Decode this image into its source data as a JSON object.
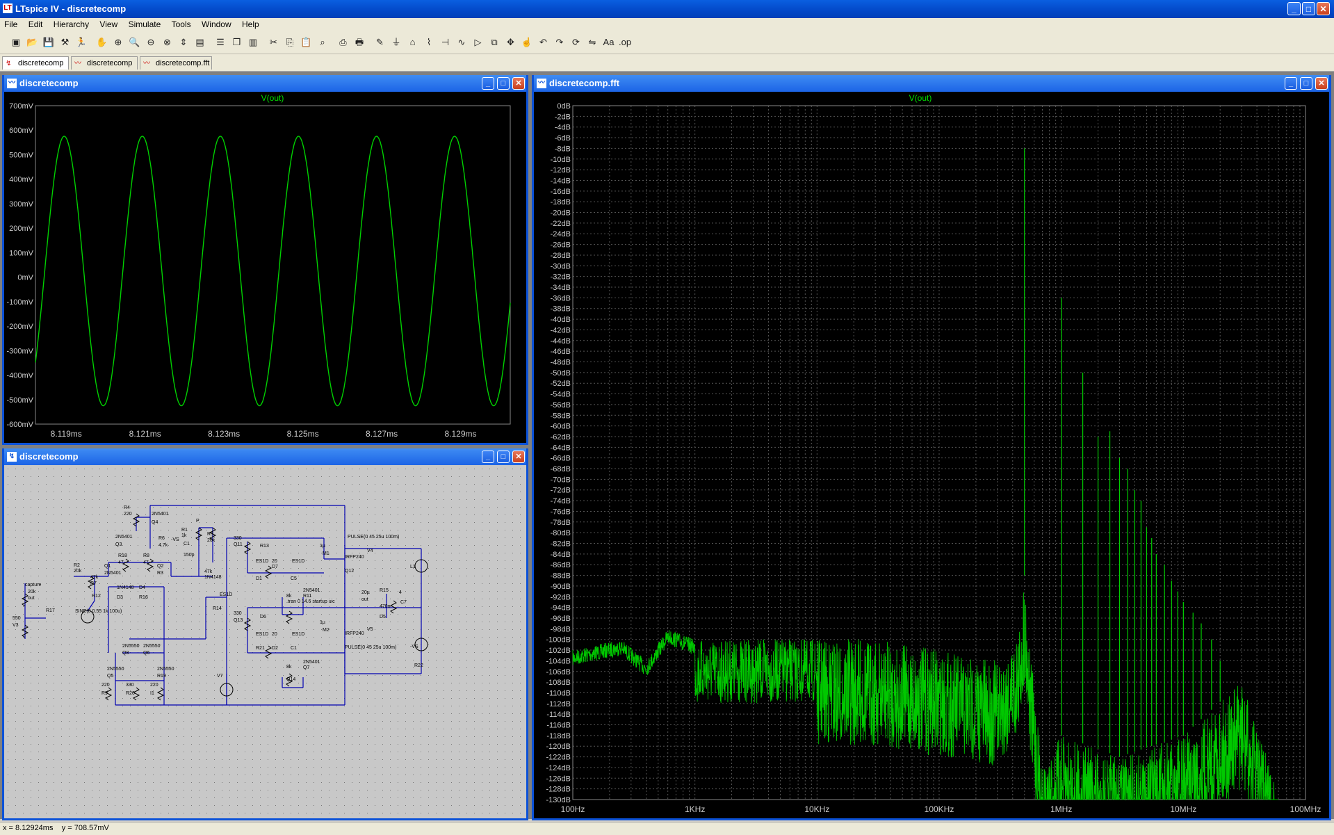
{
  "app": {
    "title": "LTspice IV - discretecomp"
  },
  "window_controls": {
    "minimize": "_",
    "maximize": "□",
    "close": "✕"
  },
  "menu": [
    "File",
    "Edit",
    "Hierarchy",
    "View",
    "Simulate",
    "Tools",
    "Window",
    "Help"
  ],
  "toolbar_icons": [
    "new-schematic-icon",
    "open-icon",
    "save-icon",
    "control-panel-icon",
    "run-icon",
    "halt-icon",
    "zoom-in-icon",
    "zoom-area-icon",
    "zoom-out-icon",
    "zoom-cancel-icon",
    "autorange-icon",
    "mark-icon",
    "tile-horizontal-icon",
    "cascade-icon",
    "tile-vertical-icon",
    "cut-icon",
    "copy-icon",
    "paste-icon",
    "find-icon",
    "print-preview-icon",
    "print-icon",
    "wire-icon",
    "ground-icon",
    "label-icon",
    "resistor-icon",
    "capacitor-icon",
    "inductor-icon",
    "diode-icon",
    "component-icon",
    "move-icon",
    "drag-icon",
    "undo-icon",
    "redo-icon",
    "rotate-icon",
    "mirror-icon",
    "text-icon",
    "spice-directive-icon"
  ],
  "tabs": [
    {
      "label": "discretecomp",
      "icon": "schematic-icon",
      "active": true
    },
    {
      "label": "discretecomp",
      "icon": "waveform-icon",
      "active": false
    },
    {
      "label": "discretecomp.fft",
      "icon": "waveform-icon",
      "active": false
    }
  ],
  "windows": {
    "wave": {
      "title": "discretecomp"
    },
    "schematic": {
      "title": "discretecomp"
    },
    "fft": {
      "title": "discretecomp.fft"
    }
  },
  "schematic": {
    "labels": [
      "R4",
      "220",
      "2N5401",
      "Q4",
      "2N5401",
      "Q3",
      "R6",
      "4.7k",
      "-VS",
      "R1",
      "1k",
      "C1",
      "150p",
      "P",
      "R5",
      "20k",
      "R18",
      "47",
      "R8",
      "47",
      "R2",
      "20k",
      "Q1",
      "2N5401",
      "Q2",
      "R3",
      "47k",
      "R7",
      "47k",
      "1N4148",
      "1N4148",
      "D3",
      "D4",
      "R16",
      "20k",
      "out",
      "capture",
      "R17",
      "550",
      "V3",
      "SINE(0 0.55 1k 100u)",
      "R12",
      "330",
      "Q11",
      "R13",
      "20",
      "D7",
      "ES1D",
      "D1",
      "ES1D",
      "C5",
      "1µ",
      "M1",
      "IRFP240",
      "Q12",
      "2N5401",
      "R11",
      "8k",
      ".tran 0 14.6 startup uic",
      "PULSE(0 45 25u 100m)",
      "V4",
      "L1",
      "20µ",
      "out",
      "R15",
      "4",
      "C7",
      "470n",
      "D5",
      "ES1D",
      "R14",
      "330",
      "Q13",
      "D6",
      "ES1D",
      "R21",
      "20",
      "D2",
      "ES1D",
      "C1",
      "1µ",
      "M2",
      "IRFP240",
      "PULSE(0 45 25u 100m)",
      "V5",
      "-VS",
      "R22",
      "8k",
      "Q14",
      "2N5401",
      "Q7",
      "2N5550",
      "Q8",
      "2N5550",
      "Q6",
      "2N5550",
      "Q5",
      "2N5550",
      "R19",
      "220",
      "R9",
      "330",
      "R20",
      "220",
      "I1",
      "V7"
    ]
  },
  "status": {
    "x": "x = 8.12924ms",
    "y": "y = 708.57mV"
  },
  "chart_data": [
    {
      "type": "line",
      "title": "V(out)",
      "xlabel": "",
      "ylabel": "",
      "x_ticks": [
        "8.119ms",
        "8.121ms",
        "8.123ms",
        "8.125ms",
        "8.127ms",
        "8.129ms"
      ],
      "y_ticks": [
        "700mV",
        "600mV",
        "500mV",
        "400mV",
        "300mV",
        "200mV",
        "100mV",
        "0mV",
        "-100mV",
        "-200mV",
        "-300mV",
        "-400mV",
        "-500mV",
        "-600mV"
      ],
      "xlim_ms": [
        8.11822,
        8.13026
      ],
      "ylim_mV": [
        -600,
        700
      ],
      "series": [
        {
          "name": "V(out)",
          "amplitude_mV": 550,
          "offset_mV": 25,
          "period_ms": 0.00198,
          "first_peak_ms": 8.11895,
          "color": "#00d000"
        }
      ],
      "grid": false
    },
    {
      "type": "line",
      "title": "V(out)",
      "xlabel": "",
      "ylabel": "",
      "x_scale": "log",
      "x_ticks": [
        "100Hz",
        "1KHz",
        "10KHz",
        "100KHz",
        "1MHz",
        "10MHz",
        "100MHz"
      ],
      "y_ticks": [
        "0dB",
        "-2dB",
        "-4dB",
        "-6dB",
        "-8dB",
        "-10dB",
        "-12dB",
        "-14dB",
        "-16dB",
        "-18dB",
        "-20dB",
        "-22dB",
        "-24dB",
        "-26dB",
        "-28dB",
        "-30dB",
        "-32dB",
        "-34dB",
        "-36dB",
        "-38dB",
        "-40dB",
        "-42dB",
        "-44dB",
        "-46dB",
        "-48dB",
        "-50dB",
        "-52dB",
        "-54dB",
        "-56dB",
        "-58dB",
        "-60dB",
        "-62dB",
        "-64dB",
        "-66dB",
        "-68dB",
        "-70dB",
        "-72dB",
        "-74dB",
        "-76dB",
        "-78dB",
        "-80dB",
        "-82dB",
        "-84dB",
        "-86dB",
        "-88dB",
        "-90dB",
        "-92dB",
        "-94dB",
        "-96dB",
        "-98dB",
        "-100dB",
        "-102dB",
        "-104dB",
        "-106dB",
        "-108dB",
        "-110dB",
        "-112dB",
        "-114dB",
        "-116dB",
        "-118dB",
        "-120dB",
        "-122dB",
        "-124dB",
        "-126dB",
        "-128dB",
        "-130dB"
      ],
      "xlim_hz": [
        100,
        100000000
      ],
      "ylim_db": [
        -130,
        0
      ],
      "grid": true,
      "peaks": [
        {
          "freq_hz": 500000,
          "db": -8
        },
        {
          "freq_hz": 1000000,
          "db": -36
        },
        {
          "freq_hz": 1500000,
          "db": -50
        },
        {
          "freq_hz": 2000000,
          "db": -62
        },
        {
          "freq_hz": 2500000,
          "db": -61
        },
        {
          "freq_hz": 3000000,
          "db": -66
        },
        {
          "freq_hz": 3500000,
          "db": -68
        },
        {
          "freq_hz": 4000000,
          "db": -72
        },
        {
          "freq_hz": 4500000,
          "db": -74
        },
        {
          "freq_hz": 5000000,
          "db": -79
        },
        {
          "freq_hz": 5500000,
          "db": -81
        },
        {
          "freq_hz": 6000000,
          "db": -84
        },
        {
          "freq_hz": 7000000,
          "db": -86
        },
        {
          "freq_hz": 8000000,
          "db": -89
        },
        {
          "freq_hz": 9000000,
          "db": -91
        },
        {
          "freq_hz": 10000000,
          "db": -93
        },
        {
          "freq_hz": 12000000,
          "db": -95
        },
        {
          "freq_hz": 14000000,
          "db": -97
        },
        {
          "freq_hz": 17000000,
          "db": -100
        },
        {
          "freq_hz": 20000000,
          "db": -104
        }
      ],
      "noise_floor": [
        {
          "freq_hz": 100,
          "db": -102
        },
        {
          "freq_hz": 250,
          "db": -100
        },
        {
          "freq_hz": 400,
          "db": -104
        },
        {
          "freq_hz": 600,
          "db": -98
        },
        {
          "freq_hz": 1000,
          "db": -100
        },
        {
          "freq_hz": 3000,
          "db": -100
        },
        {
          "freq_hz": 10000,
          "db": -100
        },
        {
          "freq_hz": 30000,
          "db": -100
        },
        {
          "freq_hz": 100000,
          "db": -102
        },
        {
          "freq_hz": 300000,
          "db": -104
        },
        {
          "freq_hz": 450000,
          "db": -98
        },
        {
          "freq_hz": 500000,
          "db": -88
        },
        {
          "freq_hz": 560000,
          "db": -102
        },
        {
          "freq_hz": 700000,
          "db": -124
        },
        {
          "freq_hz": 1000000,
          "db": -118
        },
        {
          "freq_hz": 3000000,
          "db": -122
        },
        {
          "freq_hz": 10000000,
          "db": -118
        },
        {
          "freq_hz": 30000000,
          "db": -108
        },
        {
          "freq_hz": 60000000,
          "db": -128
        }
      ],
      "series": [
        {
          "name": "V(out)",
          "color": "#00d000"
        }
      ]
    }
  ]
}
